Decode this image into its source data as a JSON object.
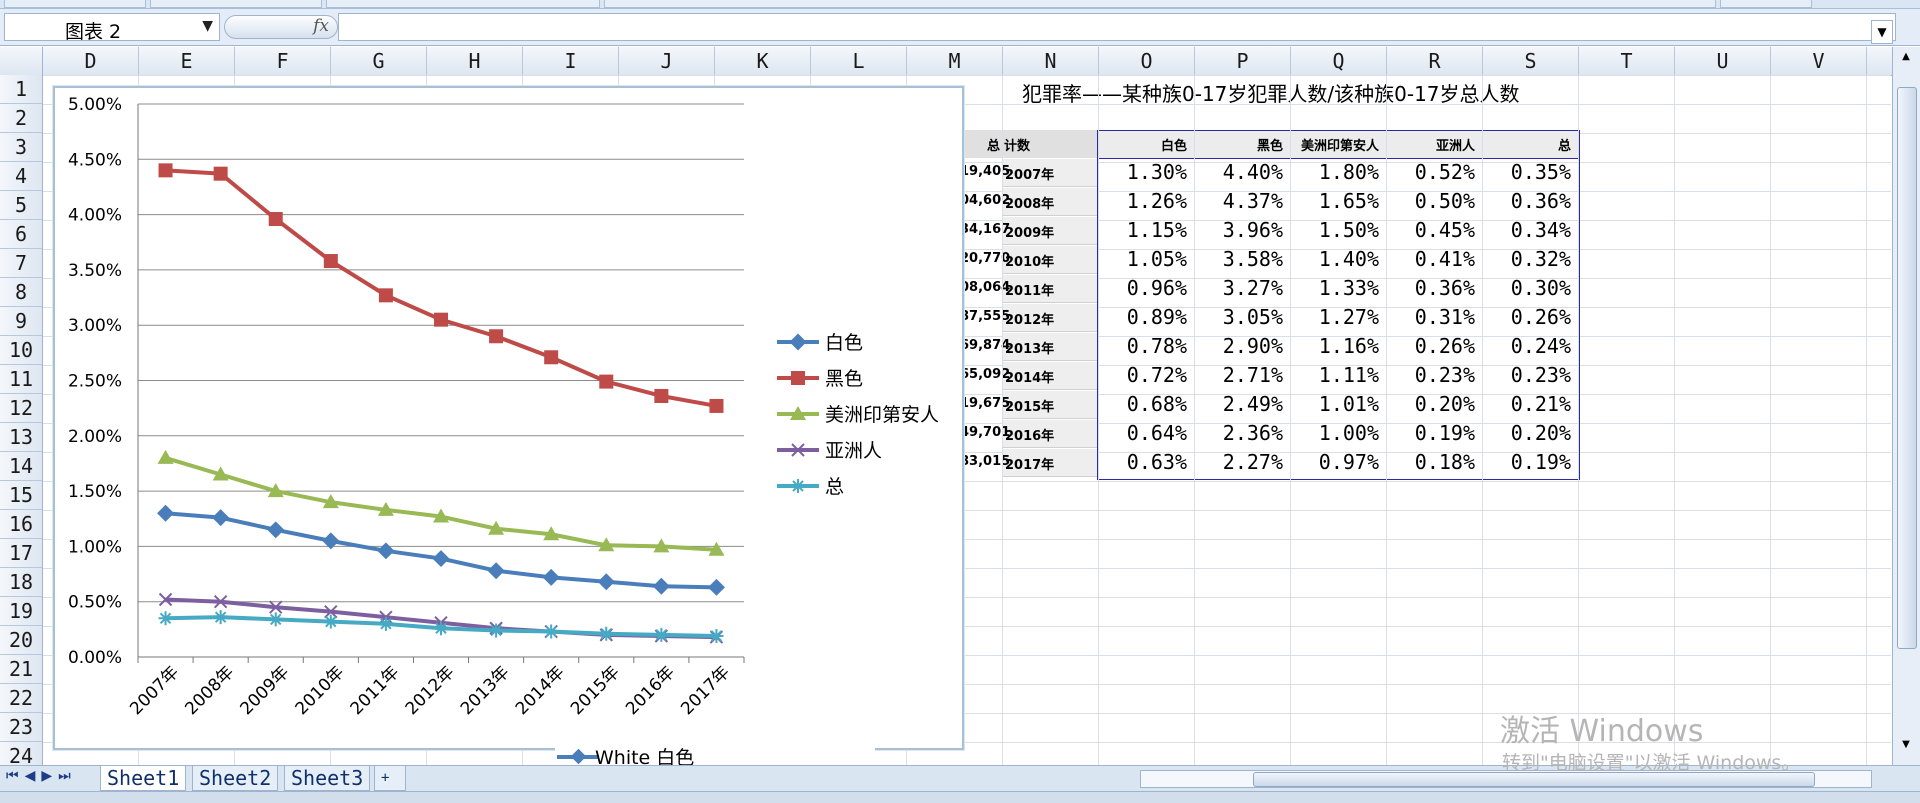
{
  "ribbon": {
    "tabs": [
      "",
      "",
      "",
      "",
      ""
    ]
  },
  "formula_bar": {
    "name_box": "图表 2",
    "fx_label": "fx",
    "value": ""
  },
  "columns": [
    "D",
    "E",
    "F",
    "G",
    "H",
    "I",
    "J",
    "K",
    "L",
    "M",
    "N",
    "O",
    "P",
    "Q",
    "R",
    "S",
    "T",
    "U",
    "V"
  ],
  "rows": [
    "1",
    "2",
    "3",
    "4",
    "5",
    "6",
    "7",
    "8",
    "9",
    "10",
    "11",
    "12",
    "13",
    "14",
    "15",
    "16",
    "17",
    "18",
    "19",
    "20",
    "21",
    "22",
    "23",
    "24"
  ],
  "title_right": "犯罪率——某种族0-17岁犯罪人数/该种族0-17岁总人数",
  "table_left": {
    "header_total": "总",
    "header_count": "计数",
    "totals": [
      "19,405",
      "04,602",
      "34,167",
      "20,770",
      "08,064",
      "87,555",
      "69,874",
      "65,092",
      "19,675",
      "49,701",
      "83,015"
    ],
    "years": [
      "2007年",
      "2008年",
      "2009年",
      "2010年",
      "2011年",
      "2012年",
      "2013年",
      "2014年",
      "2015年",
      "2016年",
      "2017年"
    ]
  },
  "table_rates": {
    "headers": [
      "白色",
      "黑色",
      "美洲印第安人",
      "亚洲人",
      "总"
    ],
    "rows": [
      [
        "1.30%",
        "4.40%",
        "1.80%",
        "0.52%",
        "0.35%"
      ],
      [
        "1.26%",
        "4.37%",
        "1.65%",
        "0.50%",
        "0.36%"
      ],
      [
        "1.15%",
        "3.96%",
        "1.50%",
        "0.45%",
        "0.34%"
      ],
      [
        "1.05%",
        "3.58%",
        "1.40%",
        "0.41%",
        "0.32%"
      ],
      [
        "0.96%",
        "3.27%",
        "1.33%",
        "0.36%",
        "0.30%"
      ],
      [
        "0.89%",
        "3.05%",
        "1.27%",
        "0.31%",
        "0.26%"
      ],
      [
        "0.78%",
        "2.90%",
        "1.16%",
        "0.26%",
        "0.24%"
      ],
      [
        "0.72%",
        "2.71%",
        "1.11%",
        "0.23%",
        "0.23%"
      ],
      [
        "0.68%",
        "2.49%",
        "1.01%",
        "0.20%",
        "0.21%"
      ],
      [
        "0.64%",
        "2.36%",
        "1.00%",
        "0.19%",
        "0.20%"
      ],
      [
        "0.63%",
        "2.27%",
        "0.97%",
        "0.18%",
        "0.19%"
      ]
    ]
  },
  "chart_data": {
    "type": "line",
    "categories": [
      "2007年",
      "2008年",
      "2009年",
      "2010年",
      "2011年",
      "2012年",
      "2013年",
      "2014年",
      "2015年",
      "2016年",
      "2017年"
    ],
    "ylim": [
      0,
      0.05
    ],
    "yticks": [
      "0.00%",
      "0.50%",
      "1.00%",
      "1.50%",
      "2.00%",
      "2.50%",
      "3.00%",
      "3.50%",
      "4.00%",
      "4.50%",
      "5.00%"
    ],
    "grid": true,
    "legend_position": "right",
    "series": [
      {
        "name": "白色",
        "color": "#4a7ebb",
        "marker": "diamond",
        "values": [
          1.3,
          1.26,
          1.15,
          1.05,
          0.96,
          0.89,
          0.78,
          0.72,
          0.68,
          0.64,
          0.63
        ]
      },
      {
        "name": "黑色",
        "color": "#be4b48",
        "marker": "square",
        "values": [
          4.4,
          4.37,
          3.96,
          3.58,
          3.27,
          3.05,
          2.9,
          2.71,
          2.49,
          2.36,
          2.27
        ]
      },
      {
        "name": "美洲印第安人",
        "color": "#98b954",
        "marker": "triangle",
        "values": [
          1.8,
          1.65,
          1.5,
          1.4,
          1.33,
          1.27,
          1.16,
          1.11,
          1.01,
          1.0,
          0.97
        ]
      },
      {
        "name": "亚洲人",
        "color": "#7d5fa0",
        "marker": "x",
        "values": [
          0.52,
          0.5,
          0.45,
          0.41,
          0.36,
          0.31,
          0.26,
          0.23,
          0.2,
          0.19,
          0.18
        ]
      },
      {
        "name": "总",
        "color": "#46aac5",
        "marker": "star",
        "values": [
          0.35,
          0.36,
          0.34,
          0.32,
          0.3,
          0.26,
          0.24,
          0.23,
          0.21,
          0.2,
          0.19
        ]
      }
    ]
  },
  "hidden_chart_legend": "White 白色",
  "sheet_tabs": [
    "Sheet1",
    "Sheet2",
    "Sheet3"
  ],
  "watermark": {
    "line1": "激活 Windows",
    "line2": "转到\"电脑设置\"以激活 Windows。"
  }
}
